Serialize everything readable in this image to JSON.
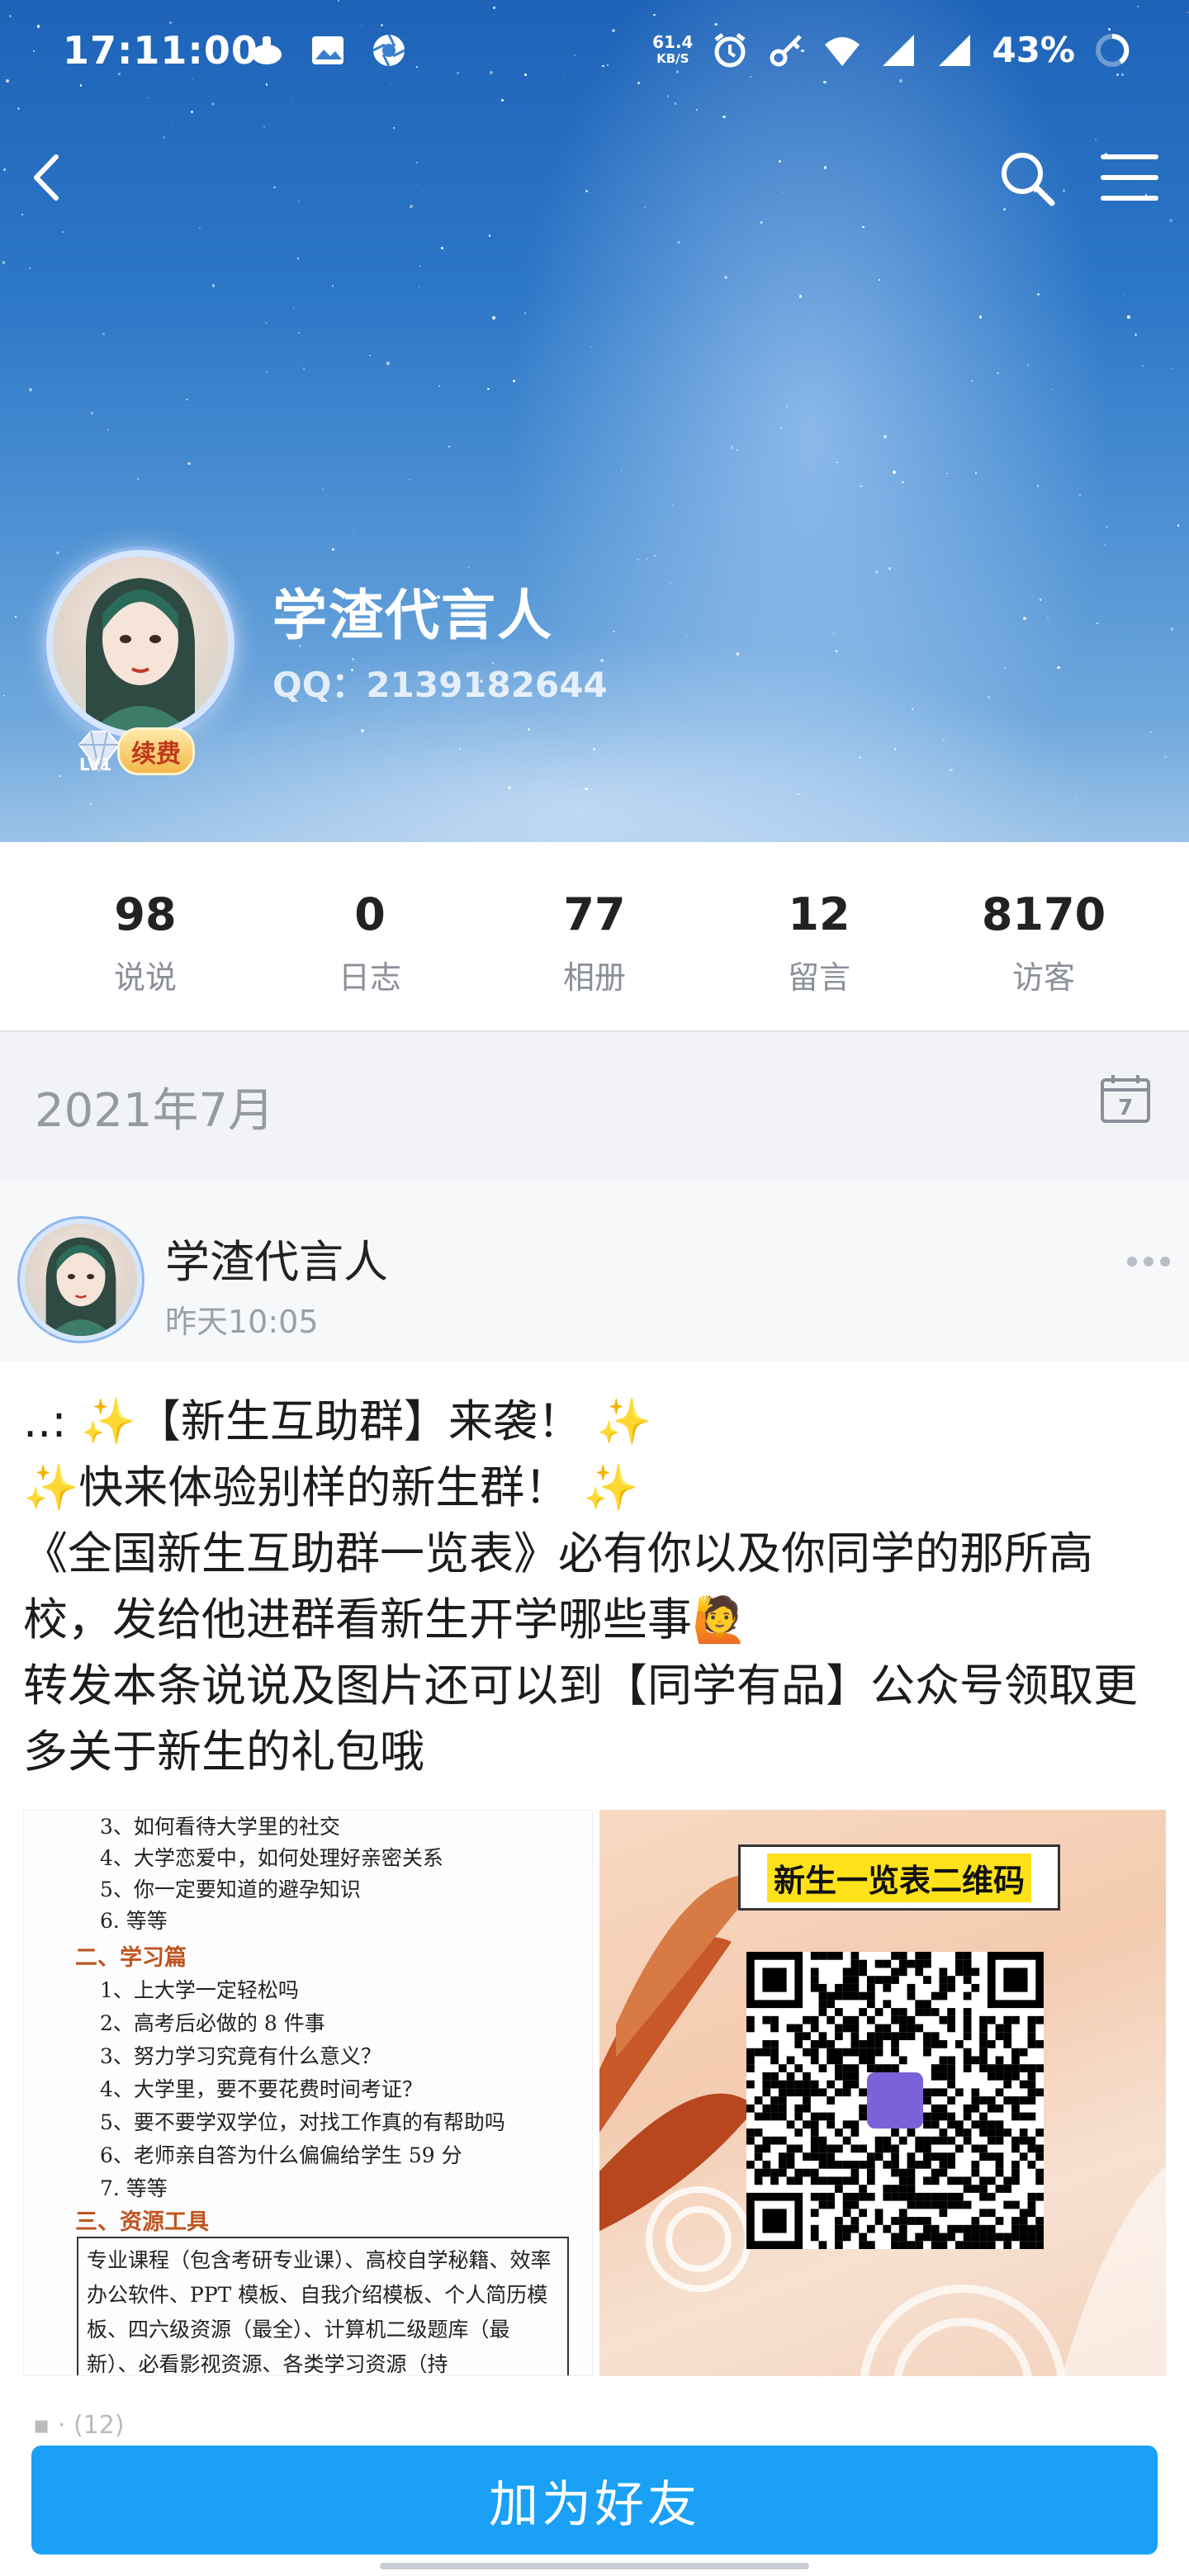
{
  "status_bar": {
    "time": "17:11:00",
    "speed_value": "61.4",
    "speed_unit": "KB/S",
    "battery": "43%"
  },
  "icons": {
    "back": "chevron-left-icon",
    "search": "search-icon",
    "menu": "menu-icon",
    "calendar": "calendar-icon",
    "more": "more-icon"
  },
  "profile": {
    "name": "学渣代言人",
    "qq": "QQ：2139182644",
    "level": "LV1",
    "renew_label": "续费"
  },
  "stats": [
    {
      "value": "98",
      "label": "说说"
    },
    {
      "value": "0",
      "label": "日志"
    },
    {
      "value": "77",
      "label": "相册"
    },
    {
      "value": "12",
      "label": "留言"
    },
    {
      "value": "8170",
      "label": "访客"
    }
  ],
  "timeline": {
    "month": "2021年7月",
    "calendar_day": "7"
  },
  "post": {
    "author": "学渣代言人",
    "time": "昨天10:05",
    "text": "..:  ✨【新生互助群】来袭！ ✨\n✨快来体验别样的新生群！ ✨\n《全国新生互助群一览表》必有你以及你同学的那所高校，发给他进群看新生开学哪些事🙋\n转发本条说说及图片还可以到【同学有品】公众号领取更多关于新生的礼包哦",
    "image1": {
      "lines": [
        "3、如何看待大学里的社交",
        "4、大学恋爱中，如何处理好亲密关系",
        "5、你一定要知道的避孕知识",
        "6. 等等"
      ],
      "section2": "二、学习篇",
      "lines2": [
        "1、上大学一定轻松吗",
        "2、高考后必做的 8 件事",
        "3、努力学习究竟有什么意义？",
        "4、大学里，要不要花费时间考证？",
        "5、要不要学双学位，对找工作真的有帮助吗",
        "6、老师亲自答为什么偏偏给学生 59 分",
        "7. 等等"
      ],
      "section3": "三、资源工具",
      "box_text": "专业课程（包含考研专业课）、高校自学秘籍、效率办公软件、PPT 模板、自我介绍模板、个人简历模板、四六级资源（最全）、计算机二级题库（最新）、必看影视资源、各类学习资源（持"
    },
    "image2": {
      "title": "新生一览表二维码"
    }
  },
  "footer": {
    "peek_text": "▪  ·  (12)",
    "add_friend": "加为好友"
  }
}
